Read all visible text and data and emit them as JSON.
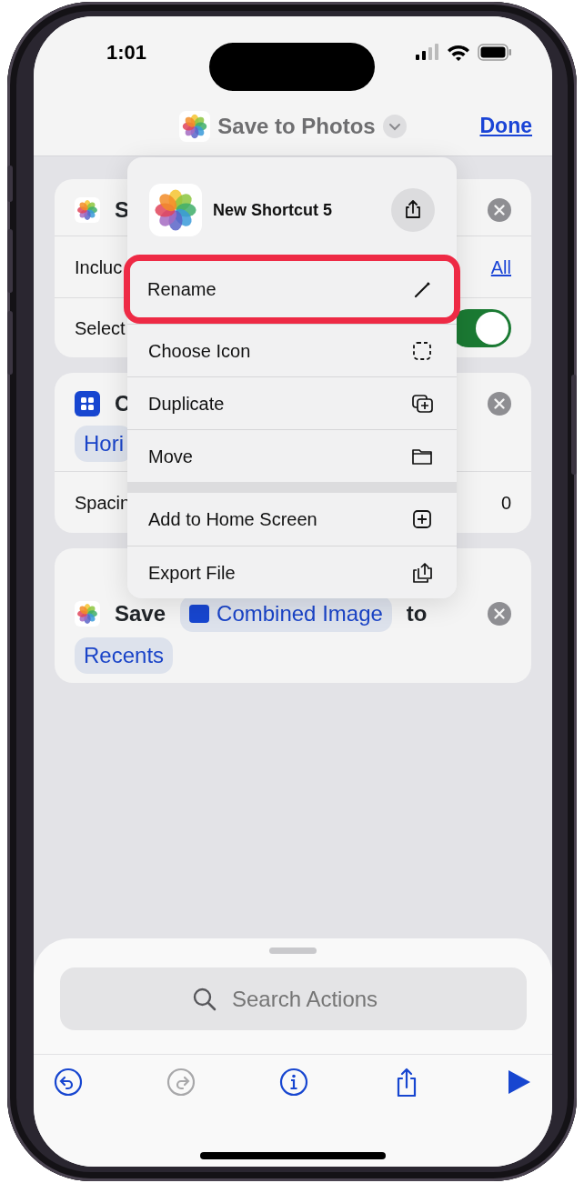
{
  "status_bar": {
    "time": "1:01"
  },
  "nav": {
    "title": "Save to Photos",
    "done": "Done"
  },
  "actions": [
    {
      "kind": "photos",
      "title": "S",
      "rows": [
        {
          "kind": "link",
          "label": "Incluc",
          "value": "All"
        },
        {
          "kind": "toggle",
          "label": "Select",
          "on": true
        }
      ]
    },
    {
      "kind": "grid",
      "title": "C",
      "tokens": [
        "Hori"
      ],
      "rows": [
        {
          "kind": "value",
          "label": "Spacin",
          "value": "0"
        }
      ]
    },
    {
      "kind": "photos",
      "title": "Save",
      "inline_token": "Combined Image",
      "after": "to",
      "tokens": [
        "Recents"
      ]
    }
  ],
  "menu": {
    "title": "New Shortcut 5",
    "groups": [
      [
        {
          "label": "Rename",
          "highlighted": true
        },
        {
          "label": "Choose Icon",
          "highlighted": false
        },
        {
          "label": "Duplicate",
          "highlighted": false
        },
        {
          "label": "Move",
          "highlighted": false
        }
      ],
      [
        {
          "label": "Add to Home Screen",
          "highlighted": false
        },
        {
          "label": "Export File",
          "highlighted": false
        }
      ]
    ]
  },
  "search": {
    "placeholder": "Search Actions"
  },
  "toolbar": [
    {
      "disabled": false
    },
    {
      "disabled": true
    },
    {
      "disabled": false
    },
    {
      "disabled": false
    },
    {
      "disabled": false
    }
  ]
}
